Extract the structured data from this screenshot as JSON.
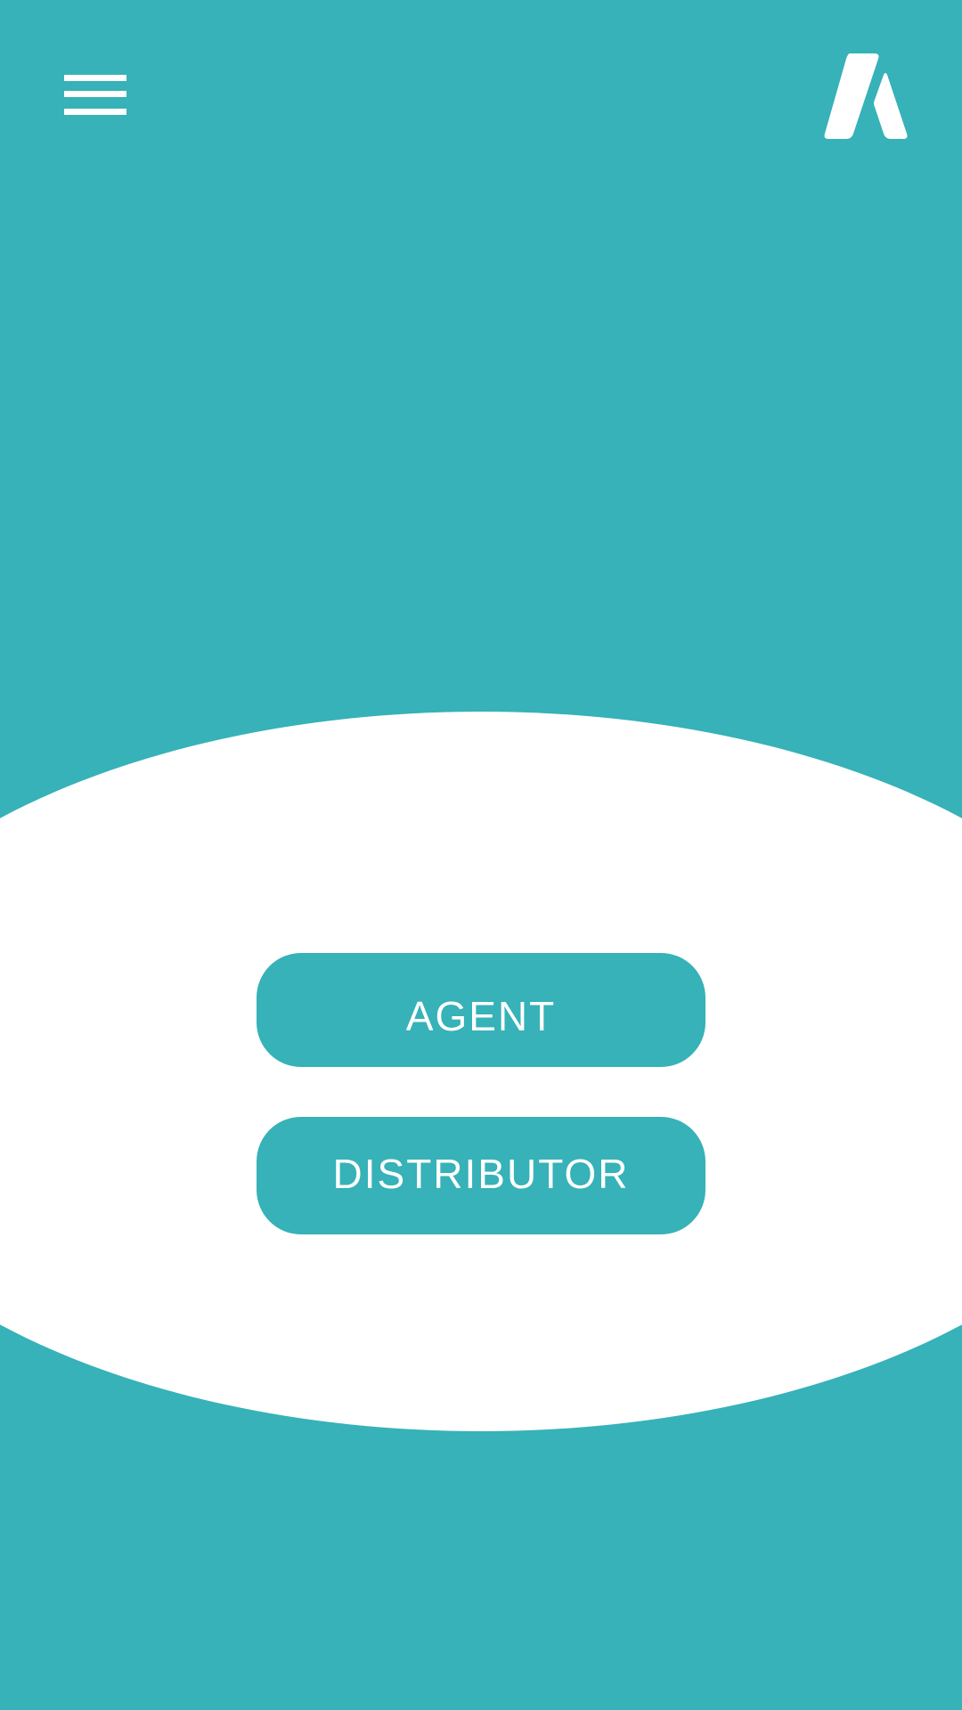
{
  "theme": {
    "background_color": "#36B2B8",
    "panel_color": "#FFFFFF",
    "button_color": "#36B2B8",
    "button_text_color": "#FFFFFF"
  },
  "header": {
    "menu_icon": "hamburger-menu-icon",
    "logo_icon": "brand-logo-icon"
  },
  "roles": {
    "agent_label": "AGENT",
    "distributor_label": "DISTRIBUTOR"
  }
}
